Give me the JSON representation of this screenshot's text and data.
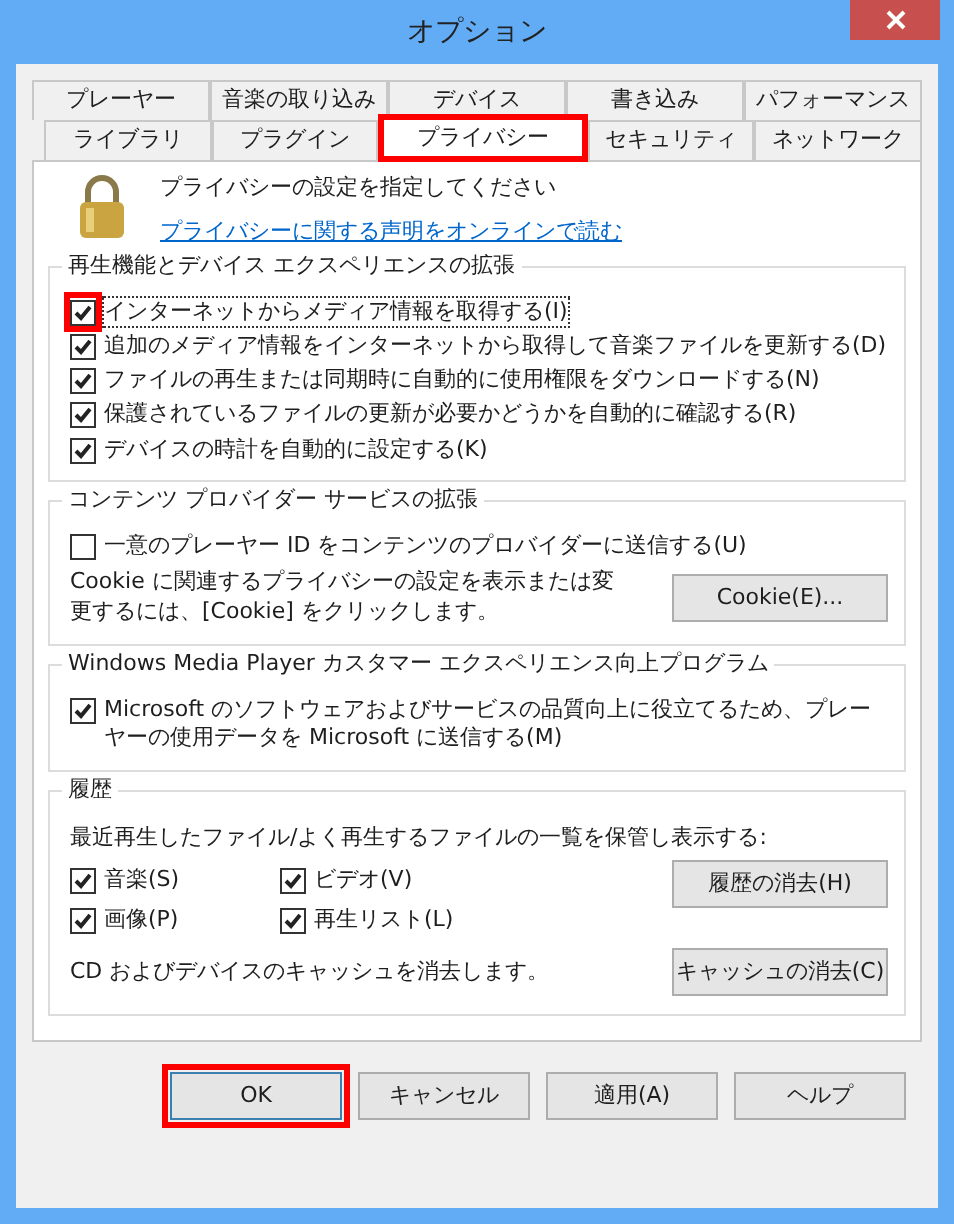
{
  "window": {
    "title": "オプション"
  },
  "tab_rows": [
    {
      "tabs": [
        {
          "label": "プレーヤー",
          "selected": false,
          "highlighted": false
        },
        {
          "label": "音楽の取り込み",
          "selected": false,
          "highlighted": false
        },
        {
          "label": "デバイス",
          "selected": false,
          "highlighted": false
        },
        {
          "label": "書き込み",
          "selected": false,
          "highlighted": false
        },
        {
          "label": "パフォーマンス",
          "selected": false,
          "highlighted": false
        }
      ]
    },
    {
      "tabs": [
        {
          "label": "ライブラリ",
          "selected": false,
          "highlighted": false
        },
        {
          "label": "プラグイン",
          "selected": false,
          "highlighted": false
        },
        {
          "label": "プライバシー",
          "selected": true,
          "highlighted": true
        },
        {
          "label": "セキュリティ",
          "selected": false,
          "highlighted": false
        },
        {
          "label": "ネットワーク",
          "selected": false,
          "highlighted": false
        }
      ]
    }
  ],
  "header": {
    "text": "プライバシーの設定を指定してください",
    "link": "プライバシーに関する声明をオンラインで読む"
  },
  "groups": [
    {
      "title": "再生機能とデバイス エクスペリエンスの拡張",
      "items": [
        {
          "kind": "checkbox",
          "label": "インターネットからメディア情報を取得する(I)",
          "checked": true,
          "highlighted": true,
          "focused": true
        },
        {
          "kind": "checkbox",
          "label": "追加のメディア情報をインターネットから取得して音楽ファイルを更新する(D)",
          "checked": true,
          "highlighted": false,
          "focused": false
        },
        {
          "kind": "checkbox",
          "label": "ファイルの再生または同期時に自動的に使用権限をダウンロードする(N)",
          "checked": true,
          "highlighted": false,
          "focused": false
        },
        {
          "kind": "checkbox",
          "label": "保護されているファイルの更新が必要かどうかを自動的に確認する(R)",
          "checked": true,
          "highlighted": false,
          "focused": false
        },
        {
          "kind": "checkbox",
          "label": "デバイスの時計を自動的に設定する(K)",
          "checked": true,
          "highlighted": false,
          "focused": false
        }
      ]
    },
    {
      "title": "コンテンツ プロバイダー サービスの拡張",
      "items": [
        {
          "kind": "checkbox",
          "label": "一意のプレーヤー ID をコンテンツのプロバイダーに送信する(U)",
          "checked": false,
          "highlighted": false,
          "focused": false
        },
        {
          "kind": "text_button",
          "text": "Cookie に関連するプライバシーの設定を表示または変更するには、[Cookie] をクリックします。",
          "button": "Cookie(E)..."
        }
      ]
    },
    {
      "title": "Windows Media Player カスタマー エクスペリエンス向上プログラム",
      "items": [
        {
          "kind": "checkbox",
          "label": "Microsoft のソフトウェアおよびサービスの品質向上に役立てるため、プレーヤーの使用データを Microsoft に送信する(M)",
          "checked": true,
          "highlighted": false,
          "focused": false
        }
      ]
    },
    {
      "title": "履歴",
      "items": [
        {
          "kind": "text",
          "text": "最近再生したファイル/よく再生するファイルの一覧を保管し表示する:"
        },
        {
          "kind": "checkgrid_button",
          "checks": [
            {
              "label": "音楽(S)",
              "checked": true
            },
            {
              "label": "ビデオ(V)",
              "checked": true
            },
            {
              "label": "画像(P)",
              "checked": true
            },
            {
              "label": "再生リスト(L)",
              "checked": true
            }
          ],
          "button": "履歴の消去(H)"
        },
        {
          "kind": "text_button",
          "text": "CD およびデバイスのキャッシュを消去します。",
          "button": "キャッシュの消去(C)"
        }
      ]
    }
  ],
  "buttons": [
    {
      "label": "OK",
      "highlighted": true,
      "default": true
    },
    {
      "label": "キャンセル",
      "highlighted": false,
      "default": false
    },
    {
      "label": "適用(A)",
      "highlighted": false,
      "default": false
    },
    {
      "label": "ヘルプ",
      "highlighted": false,
      "default": false
    }
  ]
}
